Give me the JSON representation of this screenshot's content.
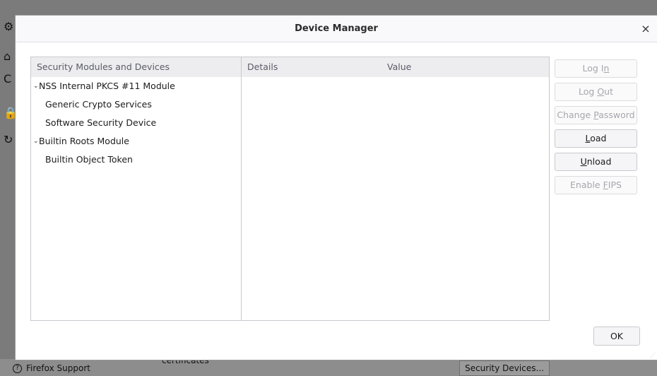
{
  "background": {
    "bottom_help": "Firefox Support",
    "bottom_cert": "certificates",
    "security_devices_button": "Security Devices..."
  },
  "dialog": {
    "title": "Device Manager",
    "close_glyph": "×"
  },
  "tree": {
    "column_header": "Security Modules and Devices",
    "rows": [
      {
        "label": "NSS Internal PKCS #11 Module",
        "kind": "parent",
        "expanded": true
      },
      {
        "label": "Generic Crypto Services",
        "kind": "child"
      },
      {
        "label": "Software Security Device",
        "kind": "child"
      },
      {
        "label": "Builtin Roots Module",
        "kind": "parent",
        "expanded": true
      },
      {
        "label": "Builtin Object Token",
        "kind": "child"
      }
    ]
  },
  "details": {
    "column_details": "Details",
    "column_value": "Value"
  },
  "buttons": {
    "login": {
      "pre": "Log I",
      "u": "n",
      "post": "",
      "enabled": false
    },
    "logout": {
      "pre": "Log ",
      "u": "O",
      "post": "ut",
      "enabled": false
    },
    "change_password": {
      "pre": "Change ",
      "u": "P",
      "post": "assword",
      "enabled": false
    },
    "load": {
      "pre": "",
      "u": "L",
      "post": "oad",
      "enabled": true
    },
    "unload": {
      "pre": "",
      "u": "U",
      "post": "nload",
      "enabled": true
    },
    "enable_fips": {
      "pre": "Enable ",
      "u": "F",
      "post": "IPS",
      "enabled": false
    },
    "ok": "OK"
  },
  "colors": {
    "disabled_text": "#a6a6ad",
    "header_bg": "#ededf0",
    "accent_blue": "#1c5fb8"
  }
}
